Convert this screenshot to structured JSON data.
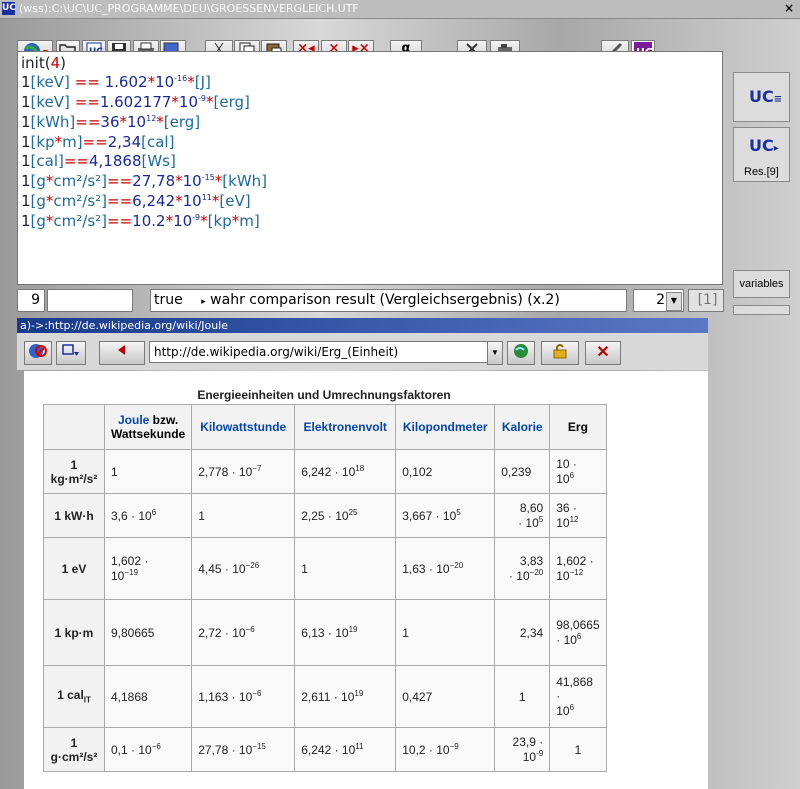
{
  "window": {
    "title": "(wss):C:\\UC\\UC_PROGRAMME\\DEU\\GROESSENVERGLEICH.UTF",
    "app_icon": "UC",
    "close": "×"
  },
  "toolbar": {
    "alpha": "α",
    "buttons": [
      "globe-icon",
      "open-folder-icon",
      "calc-icon",
      "save-icon",
      "print-icon",
      "monitor-icon",
      "cut-icon",
      "copy-icon",
      "paste-icon",
      "delete-left-icon",
      "delete-icon",
      "delete-right-icon",
      "alpha-icon",
      "tools-icon",
      "camera-icon",
      "pen-icon",
      "uc-logo-icon"
    ]
  },
  "editor": {
    "lines": [
      "init(4)",
      "1[keV] == 1.602*10⁻¹⁶*[J]",
      "1[keV] ==1.602177*10⁻⁹*[erg]",
      "1[kWh]==36*10¹²*[erg]",
      "1[kp*m]==2,34[cal]",
      "1[cal]==4,1868[Ws]",
      "1[g*cm²/s²]==27,78*10⁻¹⁵*[kWh]",
      "1[g*cm²/s²]==6,242*10¹¹*[eV]",
      "1[g*cm²/s²]==10.2*10⁻⁹*[kp*m]"
    ]
  },
  "side": {
    "res_label": "Res.[9]",
    "variables_label": "variables"
  },
  "status": {
    "line_no": "9",
    "empty": "",
    "value": "true",
    "message": "wahr comparison result (Vergleichsergebnis) (x.2)",
    "select_value": "2",
    "bracket": "[1]"
  },
  "browser": {
    "bar_title": "a)->:http://de.wikipedia.org/wiki/Joule",
    "url": "http://de.wikipedia.org/wiki/Erg_(Einheit)"
  },
  "table": {
    "caption": "Energieeinheiten und Umrechnungsfaktoren",
    "headers": [
      "",
      "Joule bzw. Wattsekunde",
      "Kilowattstunde",
      "Elektronenvolt",
      "Kilopondmeter",
      "Kalorie",
      "Erg"
    ],
    "rows": [
      [
        "1 kg·m²/s²",
        "1",
        "2,778 · 10⁻⁷",
        "6,242 · 10¹⁸",
        "0,102",
        "0,239",
        "10 · 10⁶"
      ],
      [
        "1 kW·h",
        "3,6 · 10⁶",
        "1",
        "2,25 · 10²⁵",
        "3,667 · 10⁵",
        "8,60 · 10⁵",
        "36 · 10¹²"
      ],
      [
        "1 eV",
        "1,602 · 10⁻¹⁹",
        "4,45 · 10⁻²⁶",
        "1",
        "1,63 · 10⁻²⁰",
        "3,83 · 10⁻²⁰",
        "1,602 · 10⁻¹²"
      ],
      [
        "1 kp·m",
        "9,80665",
        "2,72 · 10⁻⁶",
        "6,13 · 10¹⁹",
        "1",
        "2,34",
        "98,0665 · 10⁶"
      ],
      [
        "1 calIT",
        "4,1868",
        "1,163 · 10⁻⁶",
        "2,611 · 10¹⁹",
        "0,427",
        "1",
        "41,868 · 10⁶"
      ],
      [
        "1 g·cm²/s²",
        "0,1 · 10⁻⁶",
        "27,78 · 10⁻¹⁵",
        "6,242 · 10¹¹",
        "10,2 · 10⁻⁹",
        "23,9 · 10⁻⁹",
        "1"
      ]
    ]
  }
}
